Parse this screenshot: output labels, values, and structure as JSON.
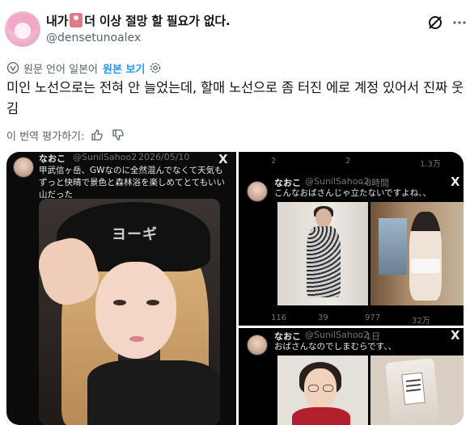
{
  "post": {
    "display_name_part1": "내가",
    "display_name_part2": "더 이상 절망 할 필요가 없다.",
    "handle": "@densetunoalex",
    "translate_label": "원문 언어 일본어",
    "show_original": "원본 보기",
    "text": "미인 노선으로는 전혀 안 늘었는데, 할매 노선으로 좀 터진 에로 계정 있어서 진짜 웃김",
    "rate_translation": "이 번역 평가하기:"
  },
  "media": {
    "left": {
      "name": "なおこ",
      "handle": "@SunilSahoo2",
      "date": "· 2026/05/10",
      "text": "甲武信ヶ岳、GWなのに全然混んでなくて天気もずっと快晴で景色と森林浴を楽しめてとてもいい山だった",
      "hat_text": "ヨーギ"
    },
    "right_top": {
      "top_stats": [
        "2",
        "2",
        "1.3万"
      ],
      "name": "なおこ",
      "handle": "@SunilSahoo2",
      "time": "· 8時間",
      "text": "こんなおばさんじゃ立たないですよね、、",
      "stats": [
        "116",
        "39",
        "977",
        "32万"
      ]
    },
    "right_bottom": {
      "name": "なおこ",
      "handle": "@SunilSahoo2",
      "time": "· 1日",
      "text": "おばさんなのでしまむらです、、"
    },
    "x_logo": "X"
  },
  "colors": {
    "link_blue": "#1d9bf0",
    "muted_gray": "#536471",
    "dark_bg": "#000000"
  },
  "icons": [
    "grok-icon",
    "more-icon",
    "translate-icon",
    "gear-icon",
    "thumbs-up-icon",
    "thumbs-down-icon",
    "reply-icon",
    "retweet-icon",
    "like-icon",
    "views-icon"
  ]
}
